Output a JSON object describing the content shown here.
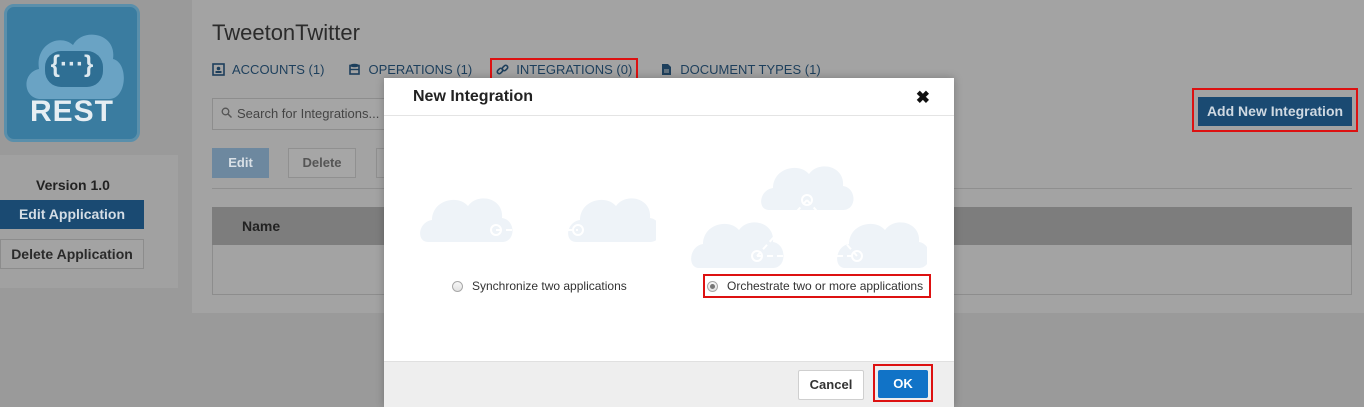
{
  "logo": {
    "text": "REST",
    "glyph": "{···}"
  },
  "sidebar": {
    "version": "Version 1.0",
    "edit_label": "Edit Application",
    "delete_label": "Delete Application"
  },
  "app": {
    "title": "TweetonTwitter"
  },
  "tabs": [
    {
      "label": "ACCOUNTS (1)",
      "icon": "id-card-icon"
    },
    {
      "label": "OPERATIONS (1)",
      "icon": "database-icon"
    },
    {
      "label": "INTEGRATIONS (0)",
      "icon": "link-icon"
    },
    {
      "label": "DOCUMENT TYPES (1)",
      "icon": "document-icon"
    }
  ],
  "search": {
    "placeholder": "Search for Integrations..."
  },
  "toolbar": {
    "add_label": "Add New Integration",
    "edit_label": "Edit",
    "delete_label": "Delete"
  },
  "table": {
    "columns": [
      "Name"
    ]
  },
  "modal": {
    "title": "New Integration",
    "close": "✖",
    "options": [
      {
        "label": "Synchronize two applications",
        "selected": false
      },
      {
        "label": "Orchestrate two or more applications",
        "selected": true
      }
    ],
    "cancel_label": "Cancel",
    "ok_label": "OK"
  },
  "colors": {
    "primary": "#1173c7",
    "highlight": "#dd1111",
    "brand_dark": "#1a4a72"
  }
}
